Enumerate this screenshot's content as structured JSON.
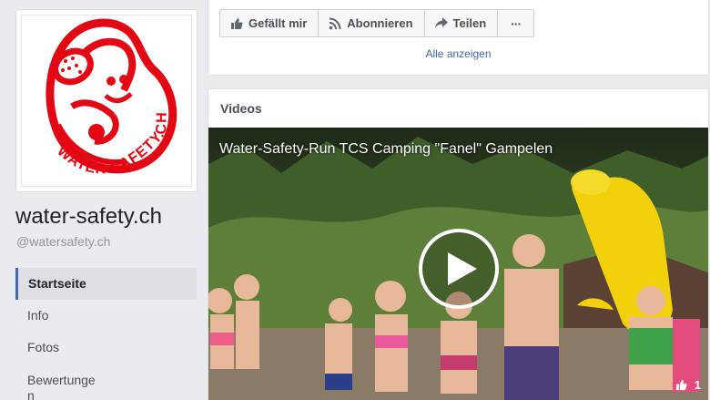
{
  "page": {
    "name": "water-safety.ch",
    "handle": "@watersafety.ch",
    "logo_text": "WATER-SAFETY.CH"
  },
  "nav": {
    "items": [
      {
        "label": "Startseite",
        "active": true
      },
      {
        "label": "Info",
        "active": false
      },
      {
        "label": "Fotos",
        "active": false
      },
      {
        "label": "Bewertunge\nn",
        "active": false
      }
    ]
  },
  "actions": {
    "like": {
      "label": "Gefällt mir",
      "icon": "thumbs-up-icon"
    },
    "subscribe": {
      "label": "Abonnieren",
      "icon": "rss-icon"
    },
    "share": {
      "label": "Teilen",
      "icon": "share-arrow-icon"
    },
    "more": {
      "label": "···",
      "icon": "more-dots-icon"
    }
  },
  "top_card": {
    "show_all": "Alle anzeigen"
  },
  "videos": {
    "title": "Videos",
    "video": {
      "title": "Water-Safety-Run TCS Camping \"Fanel\" Gampelen",
      "likes": "1"
    }
  },
  "colors": {
    "brand_red": "#e30613",
    "link_blue": "#4267b2",
    "active_border": "#4267b2"
  }
}
